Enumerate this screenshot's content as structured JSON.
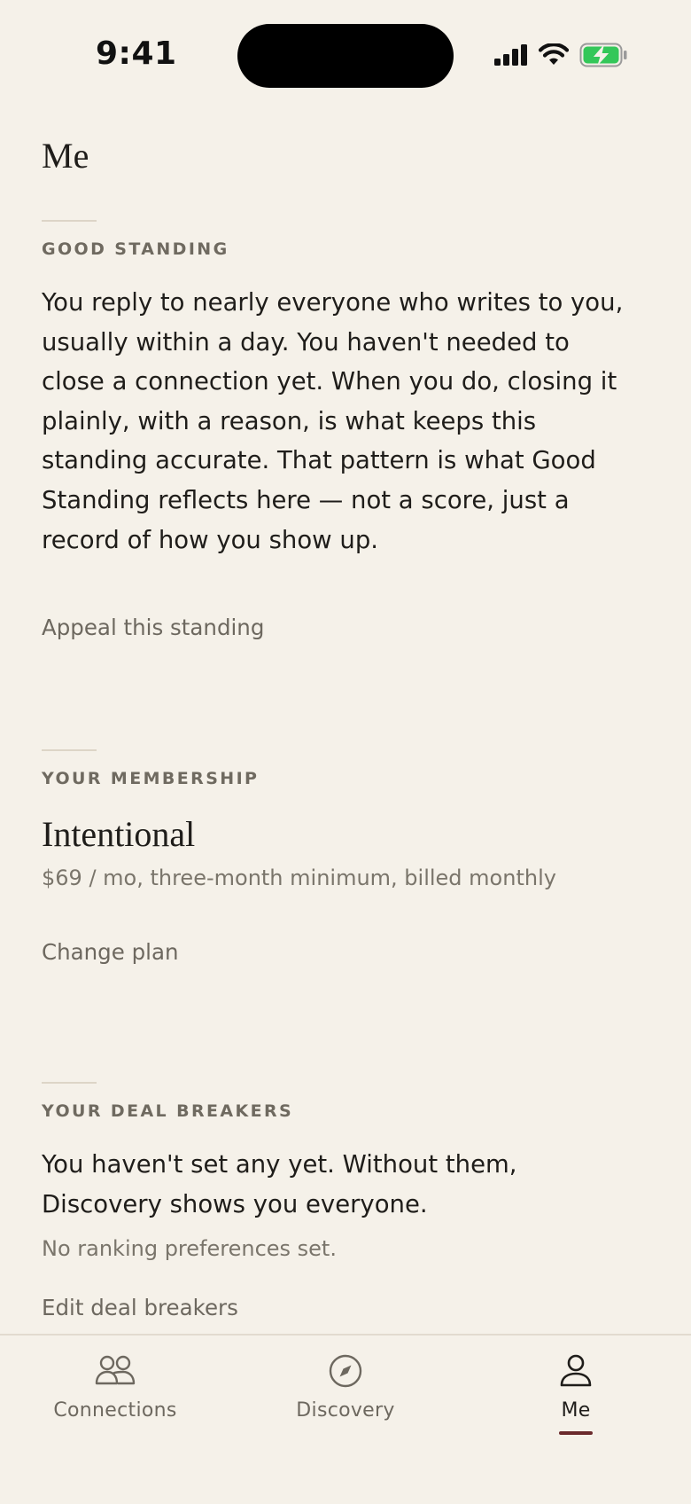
{
  "status_bar": {
    "time": "9:41",
    "icons": [
      "signal-icon",
      "wifi-icon",
      "battery-charging-icon"
    ],
    "battery_color": "#34c759"
  },
  "page": {
    "title": "Me"
  },
  "good_standing": {
    "eyebrow": "GOOD STANDING",
    "lines": [
      "You reply to nearly everyone who writes to you,",
      "usually within a day. You haven't needed to",
      "close a connection yet. When you do, closing it",
      "plainly, with a reason, is what keeps this",
      "standing accurate. That pattern is what Good",
      "Standing reflects here — not a score, just a",
      "record of how you show up."
    ],
    "appeal_link": "Appeal this standing"
  },
  "membership": {
    "eyebrow": "YOUR MEMBERSHIP",
    "plan_name": "Intentional",
    "plan_details": "$69 / mo, three-month minimum, billed monthly",
    "change_link": "Change plan"
  },
  "deal_breakers": {
    "eyebrow": "YOUR DEAL BREAKERS",
    "lines": [
      "You haven't set any yet. Without them,",
      "Discovery shows you everyone."
    ],
    "ranking_note": "No ranking preferences set.",
    "edit_link": "Edit deal breakers"
  },
  "tabbar": {
    "tabs": [
      {
        "label": "Connections",
        "icon": "people-icon",
        "active": false
      },
      {
        "label": "Discovery",
        "icon": "compass-icon",
        "active": false
      },
      {
        "label": "Me",
        "icon": "person-icon",
        "active": true
      }
    ],
    "active_color": "#6b2a2c"
  }
}
